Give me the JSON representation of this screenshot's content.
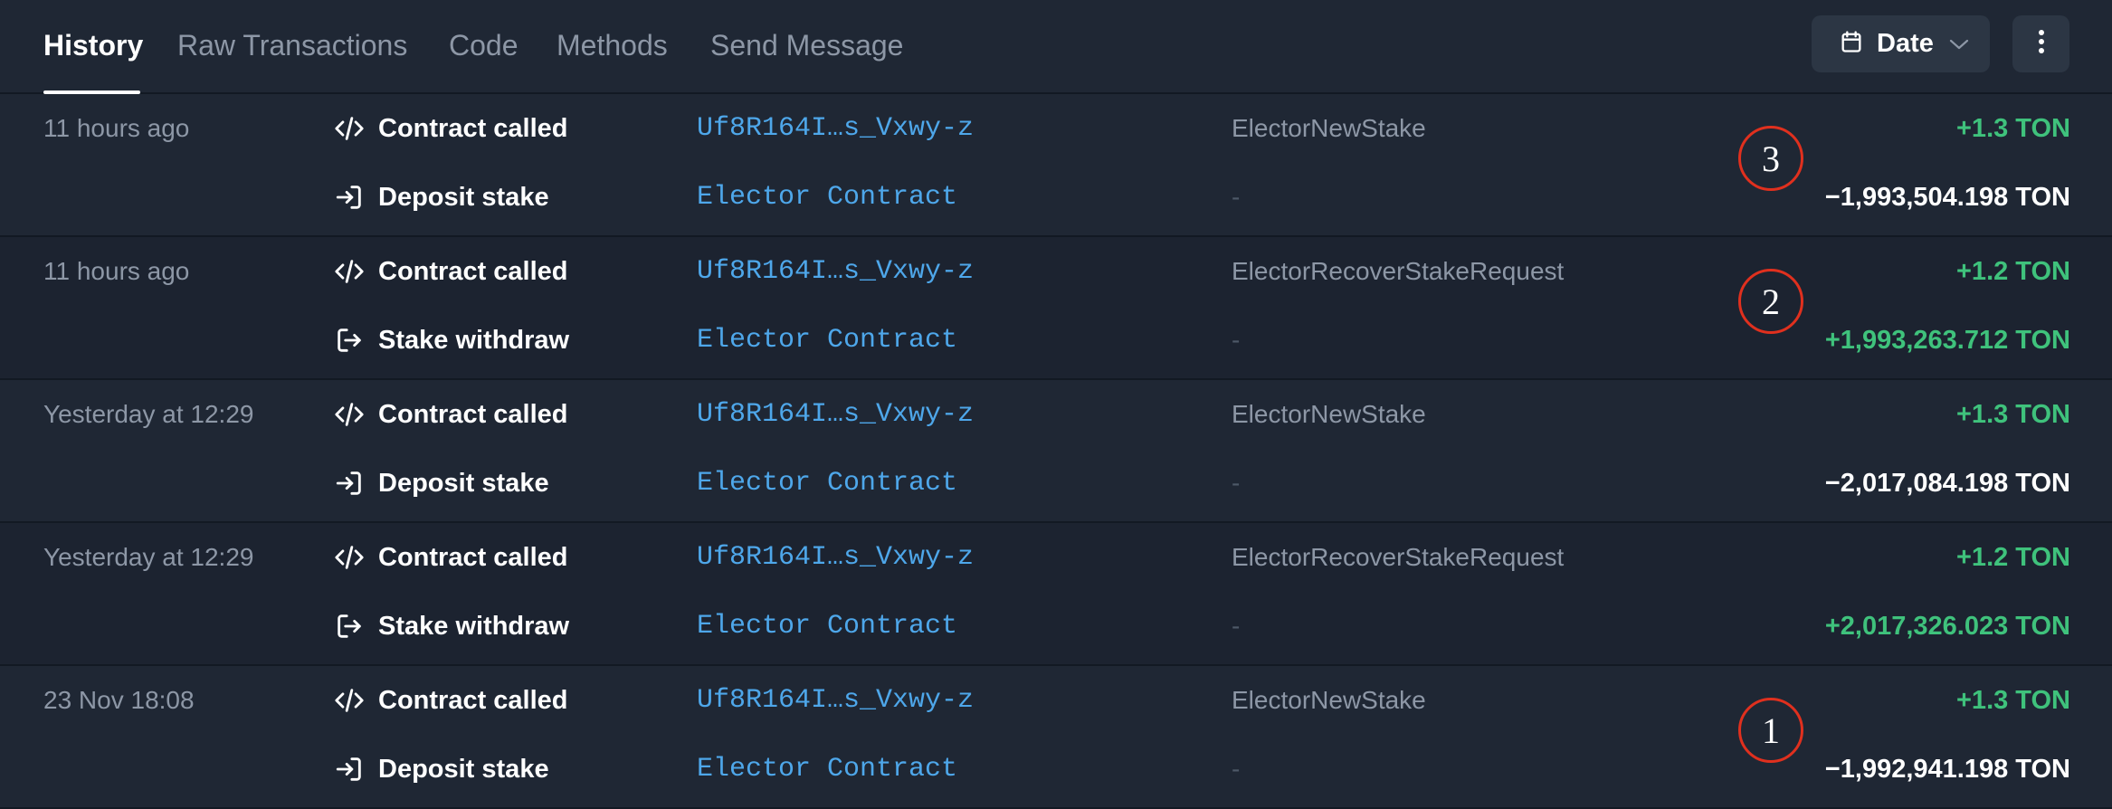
{
  "tabs": [
    {
      "label": "History",
      "active": true
    },
    {
      "label": "Raw Transactions",
      "active": false
    },
    {
      "label": "Code",
      "active": false
    },
    {
      "label": "Methods",
      "active": false
    },
    {
      "label": "Send Message",
      "active": false
    }
  ],
  "toolbar": {
    "date_label": "Date",
    "date_icon": "calendar-icon",
    "more_icon": "more-vertical-icon"
  },
  "colors": {
    "background": "#1f2734",
    "link": "#4ea7ea",
    "positive": "#3fc27c",
    "marker": "#e0301e"
  },
  "transactions": [
    {
      "time": "11 hours ago",
      "marker": "3",
      "lines": [
        {
          "icon": "code-icon",
          "action": "Contract called",
          "address": "Uf8R164I…s_Vxwy-z",
          "operation": "ElectorNewStake",
          "amount": "+1.3 TON",
          "sign": "pos"
        },
        {
          "icon": "sign-in-icon",
          "action": "Deposit stake",
          "address": "Elector Contract",
          "operation": "-",
          "amount": "−1,993,504.198 TON",
          "sign": "neg"
        }
      ]
    },
    {
      "time": "11 hours ago",
      "marker": "2",
      "lines": [
        {
          "icon": "code-icon",
          "action": "Contract called",
          "address": "Uf8R164I…s_Vxwy-z",
          "operation": "ElectorRecoverStakeRequest",
          "amount": "+1.2 TON",
          "sign": "pos"
        },
        {
          "icon": "sign-out-icon",
          "action": "Stake withdraw",
          "address": "Elector Contract",
          "operation": "-",
          "amount": "+1,993,263.712 TON",
          "sign": "pos"
        }
      ]
    },
    {
      "time": "Yesterday at 12:29",
      "marker": "",
      "lines": [
        {
          "icon": "code-icon",
          "action": "Contract called",
          "address": "Uf8R164I…s_Vxwy-z",
          "operation": "ElectorNewStake",
          "amount": "+1.3 TON",
          "sign": "pos"
        },
        {
          "icon": "sign-in-icon",
          "action": "Deposit stake",
          "address": "Elector Contract",
          "operation": "-",
          "amount": "−2,017,084.198 TON",
          "sign": "neg"
        }
      ]
    },
    {
      "time": "Yesterday at 12:29",
      "marker": "",
      "lines": [
        {
          "icon": "code-icon",
          "action": "Contract called",
          "address": "Uf8R164I…s_Vxwy-z",
          "operation": "ElectorRecoverStakeRequest",
          "amount": "+1.2 TON",
          "sign": "pos"
        },
        {
          "icon": "sign-out-icon",
          "action": "Stake withdraw",
          "address": "Elector Contract",
          "operation": "-",
          "amount": "+2,017,326.023 TON",
          "sign": "pos"
        }
      ]
    },
    {
      "time": "23 Nov 18:08",
      "marker": "1",
      "lines": [
        {
          "icon": "code-icon",
          "action": "Contract called",
          "address": "Uf8R164I…s_Vxwy-z",
          "operation": "ElectorNewStake",
          "amount": "+1.3 TON",
          "sign": "pos"
        },
        {
          "icon": "sign-in-icon",
          "action": "Deposit stake",
          "address": "Elector Contract",
          "operation": "-",
          "amount": "−1,992,941.198 TON",
          "sign": "neg"
        }
      ]
    }
  ]
}
